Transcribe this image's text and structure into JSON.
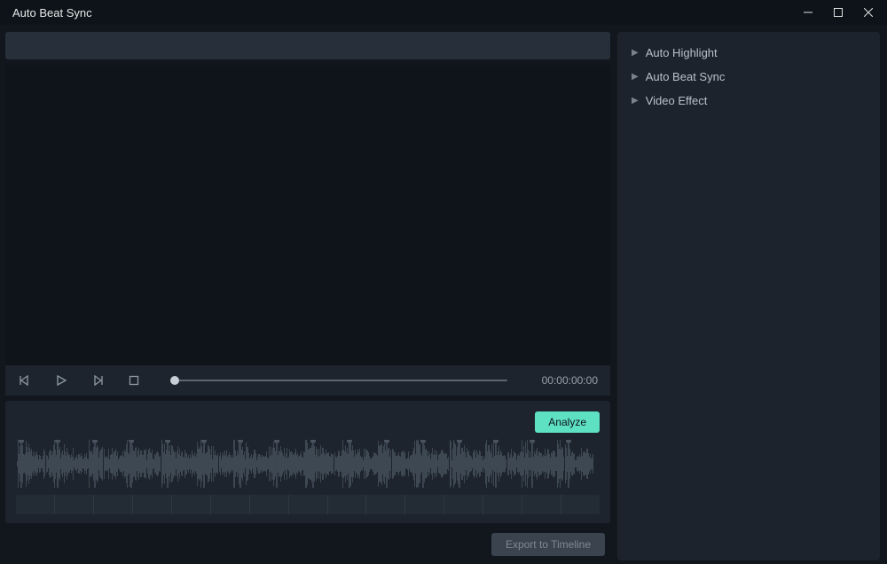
{
  "titlebar": {
    "title": "Auto Beat Sync"
  },
  "transport": {
    "timecode": "00:00:00:00"
  },
  "audio": {
    "analyze_label": "Analyze"
  },
  "footer": {
    "export_label": "Export to Timeline"
  },
  "sidebar": {
    "items": [
      {
        "label": "Auto Highlight"
      },
      {
        "label": "Auto Beat Sync"
      },
      {
        "label": "Video Effect"
      }
    ]
  },
  "colors": {
    "accent": "#5ee0c3"
  }
}
